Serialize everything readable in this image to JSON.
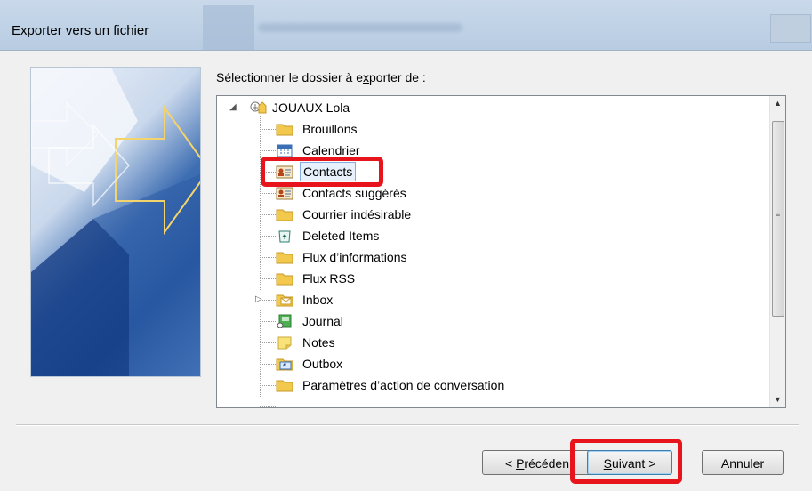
{
  "window": {
    "title": "Exporter vers un fichier"
  },
  "prompt": {
    "before": "Sélectionner le dossier à e",
    "accesskey": "x",
    "after": "porter de :"
  },
  "tree": {
    "root_label": "JOUAUX Lola",
    "items": [
      {
        "label": "Brouillons",
        "icon": "folder-icon"
      },
      {
        "label": "Calendrier",
        "icon": "calendar-icon"
      },
      {
        "label": "Contacts",
        "icon": "contacts-icon",
        "selected": true
      },
      {
        "label": "Contacts suggérés",
        "icon": "contacts-icon"
      },
      {
        "label": "Courrier indésirable",
        "icon": "folder-icon"
      },
      {
        "label": "Deleted Items",
        "icon": "trash-icon"
      },
      {
        "label": "Flux d’informations",
        "icon": "folder-icon"
      },
      {
        "label": "Flux RSS",
        "icon": "folder-icon"
      },
      {
        "label": "Inbox",
        "icon": "inbox-icon",
        "expandable": true
      },
      {
        "label": "Journal",
        "icon": "journal-icon"
      },
      {
        "label": "Notes",
        "icon": "notes-icon"
      },
      {
        "label": "Outbox",
        "icon": "outbox-icon"
      },
      {
        "label": "Paramètres d’action de conversation",
        "icon": "folder-icon"
      }
    ]
  },
  "buttons": {
    "back": {
      "before": "< ",
      "accesskey": "P",
      "after": "récéden"
    },
    "next": {
      "accesskey": "S",
      "after": "uivant >"
    },
    "cancel": "Annuler"
  },
  "colors": {
    "highlight": "#e8141b",
    "folder": "#f2c94c",
    "selection": "#e8f1fb"
  }
}
